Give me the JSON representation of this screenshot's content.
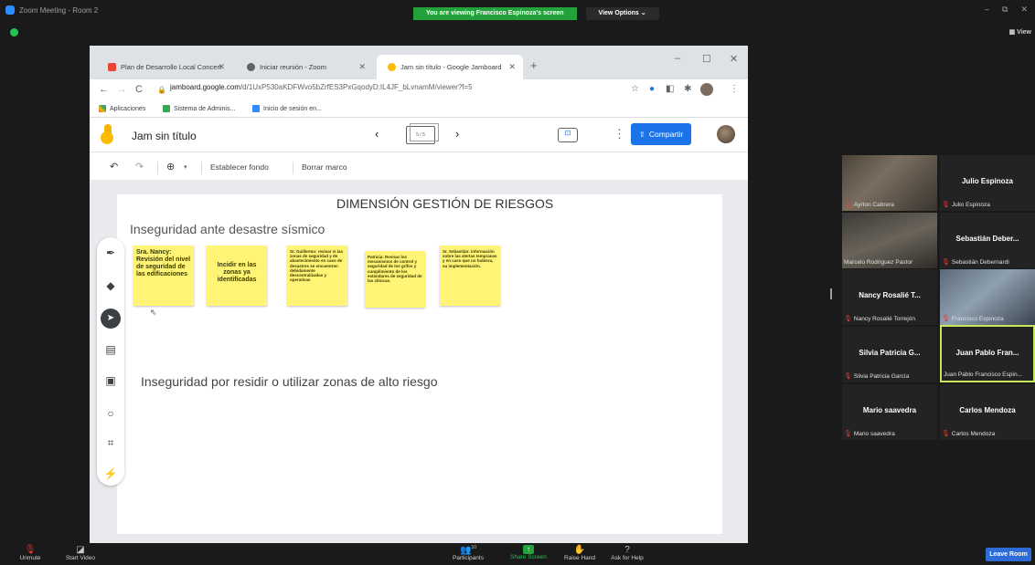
{
  "zoom": {
    "window_title": "Zoom Meeting - Room 2",
    "banner_viewing": "You are viewing Francisco Espinoza's screen",
    "view_options": "View Options ⌄",
    "view_label": "▦ View",
    "win_minimize": "–",
    "win_maximize": "⧉",
    "win_close": "✕"
  },
  "browser": {
    "tabs": [
      {
        "label": "Plan de Desarrollo Local Concert",
        "close": "✕"
      },
      {
        "label": "Iniciar reunión - Zoom",
        "close": "✕"
      },
      {
        "label": "Jam sin título - Google Jamboard",
        "close": "✕"
      }
    ],
    "new_tab": "+",
    "minimize": "–",
    "maximize": "☐",
    "close": "✕",
    "back": "←",
    "forward": "→",
    "reload": "C",
    "url_domain": "jamboard.google.com",
    "url_path": "/d/1UxP530aKDFWvo5bZrfES3PxGqodyD:IL4JF_bLvnamM/viewer?f=5",
    "bookmarks": [
      {
        "label": "Aplicaciones"
      },
      {
        "label": "Sistema de Adminis..."
      },
      {
        "label": "Inicio de sesión en..."
      }
    ]
  },
  "jamboard": {
    "title": "Jam sin título",
    "prev_frame": "‹",
    "next_frame": "›",
    "frame_indicator": "5 / 5",
    "share_label": "Compartir",
    "more": "⋮",
    "toolbar": {
      "undo": "↶",
      "redo": "↷",
      "zoom": "⊕",
      "zoom_caret": "▾",
      "set_background": "Establecer fondo",
      "clear_frame": "Borrar marco"
    },
    "frame": {
      "title": "DIMENSIÓN GESTIÓN DE RIESGOS",
      "subtitle1": "Inseguridad ante desastre sísmico",
      "subtitle2": "Inseguridad por residir o utilizar zonas de alto riesgo",
      "stickies": [
        "Sra. Nancy: Revisión del nivel de seguridad de las edificaciones",
        "Incidir en las zonas ya identificadas",
        "Sr. Guillermo: revisar si las zonas de seguridad y de abastecimiento en caso de desastres se encuentren debidamente descentralizadas y operativas",
        "Patricia: Revisar los mecanismos de control y seguridad de los grifos y cumplimiento de los estándares de seguridad de las clínicas.",
        "Sr. Sebastián: información sobre las alertas tempranas y en caso que no hubiera, su implementación."
      ],
      "sticky_color": "#fff475"
    }
  },
  "participants": [
    {
      "name": "",
      "label": "Ayrton Cabrera",
      "video": true
    },
    {
      "name": "Julio Espinoza",
      "label": "Julio Espinoza",
      "video": false
    },
    {
      "name": "",
      "label": "Marcelo Rodriguez Pastor",
      "video": true
    },
    {
      "name": "Sebastián Deber...",
      "label": "Sebastián Debernardi",
      "video": false
    },
    {
      "name": "Nancy Rosalié T...",
      "label": "Nancy Rosalié Torrejón",
      "video": false
    },
    {
      "name": "",
      "label": "Francisco Espinoza",
      "video": true
    },
    {
      "name": "Silvia Patricia G...",
      "label": "Silvia Patricia García",
      "video": false
    },
    {
      "name": "Juan Pablo Fran...",
      "label": "Juan Pablo Francisco Espin...",
      "video": false
    },
    {
      "name": "Mario saavedra",
      "label": "Mario saavedra",
      "video": false
    },
    {
      "name": "Carlos Mendoza",
      "label": "Carlos Mendoza",
      "video": false
    }
  ],
  "bottom_bar": {
    "unmute": "Unmute",
    "start_video": "Start Video",
    "participants": "Participants",
    "participants_count": "10",
    "share_screen": "Share Screen",
    "raise_hand": "Raise Hand",
    "ask_help": "Ask for Help",
    "leave": "Leave Room"
  },
  "colors": {
    "zoom_green": "#23a13a",
    "jam_blue": "#1a73e8",
    "active_speaker": "#c7e65b",
    "leave_blue": "#2d6bd6"
  }
}
